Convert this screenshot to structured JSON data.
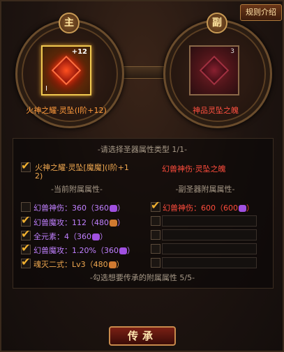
{
  "header": {
    "rules_label": "规则介绍"
  },
  "slots": {
    "main": {
      "badge": "主",
      "enhance": "+12",
      "tier": "I",
      "name": "火神之耀·灵坠(I阶+12)"
    },
    "sub": {
      "badge": "副",
      "count": "3",
      "name": "神品灵坠之魄"
    }
  },
  "select": {
    "title": "-请选择圣器属性类型 1/1-",
    "main_option_line1": "火神之耀·灵坠[魔魔](I阶+1",
    "main_option_line2": "2)",
    "sub_option": "幻兽神伤·灵坠之魄"
  },
  "current_attrs": {
    "title": "-当前附属属性-",
    "items": [
      {
        "label": "幻兽神伤：360（360",
        "checked": false,
        "color": "purple",
        "icon": "purple"
      },
      {
        "label": "幻兽魔攻：112（480",
        "checked": true,
        "color": "purple",
        "icon": "orange"
      },
      {
        "label": "全元素：4（360",
        "checked": true,
        "color": "purple",
        "icon": "purple"
      },
      {
        "label": "幻兽魔攻：1.20%（360",
        "checked": true,
        "color": "purple",
        "icon": "purple"
      },
      {
        "label": "魂灭二式：Lv3（480",
        "checked": true,
        "color": "orange",
        "icon": "orange"
      }
    ]
  },
  "sub_attrs": {
    "title": "-副圣器附属属性-",
    "items": [
      {
        "label": "幻兽神伤：600（600",
        "checked": true
      }
    ]
  },
  "footer_note": "-勾选想要传承的附属属性 5/5-",
  "inherit_label": "传承",
  "colors": {
    "accent": "#f0b030",
    "red": "#ff4c3c",
    "purple": "#c080ff"
  }
}
